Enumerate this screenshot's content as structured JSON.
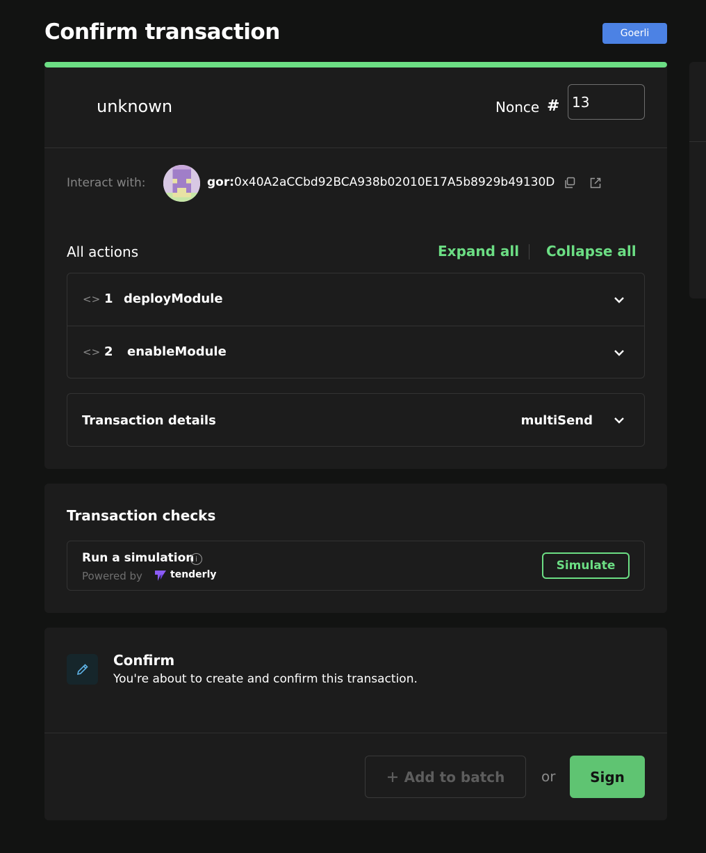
{
  "page": {
    "title": "Confirm transaction",
    "network": "Goerli"
  },
  "progress": {
    "fraction": 1.0,
    "color": "#6cde84"
  },
  "transaction": {
    "name": "unknown",
    "nonce_label": "Nonce",
    "nonce_hash": "#",
    "nonce_value": "13"
  },
  "interact": {
    "label": "Interact with:",
    "prefix": "gor:",
    "address": "0x40A2aCCbd92BCA938b02010E17A5b8929b49130D"
  },
  "actions": {
    "label": "All actions",
    "expand_all": "Expand all",
    "collapse_all": "Collapse all",
    "items": [
      {
        "index": "1",
        "name": "deployModule"
      },
      {
        "index": "2",
        "name": "enableModule"
      }
    ]
  },
  "details": {
    "label": "Transaction details",
    "value": "multiSend"
  },
  "checks": {
    "title": "Transaction checks",
    "simulation_title": "Run a simulation",
    "powered_by": "Powered by",
    "provider": "tenderly",
    "simulate_label": "Simulate"
  },
  "confirm": {
    "title": "Confirm",
    "description": "You're about to create and confirm this transaction.",
    "add_to_batch": "Add to batch",
    "or": "or",
    "sign": "Sign"
  },
  "colors": {
    "accent": "#6cde84",
    "background": "#121312",
    "card": "#1c1c1c",
    "network_badge": "#4c82e4"
  },
  "icons": [
    "copy-icon",
    "external-link-icon",
    "code-icon",
    "chevron-down-icon",
    "info-icon",
    "tenderly-logo-icon",
    "pencil-icon",
    "plus-icon"
  ]
}
